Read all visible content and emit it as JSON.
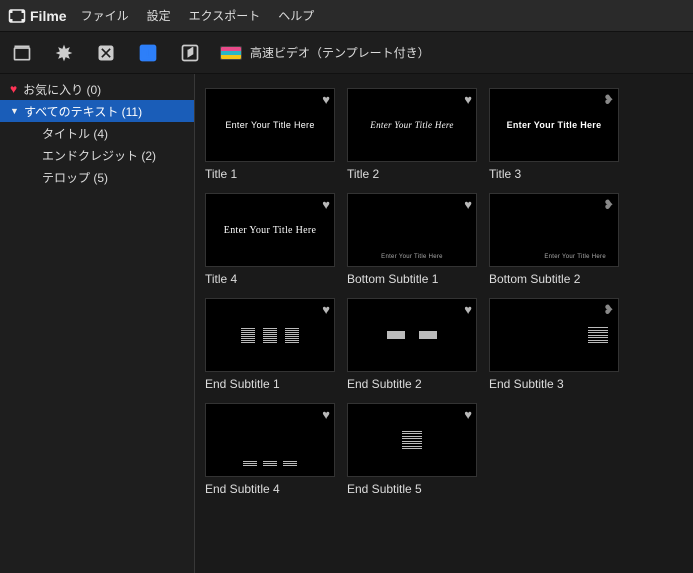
{
  "app": {
    "name": "Filme"
  },
  "menu": [
    "ファイル",
    "設定",
    "エクスポート",
    "ヘルプ"
  ],
  "toolbar": {
    "quickvideo_label": "高速ビデオ（テンプレート付き）"
  },
  "sidebar": {
    "items": [
      {
        "label": "お気に入り (0)",
        "icon": "heart"
      },
      {
        "label": "すべてのテキスト (11)",
        "icon": "disclosure",
        "selected": true
      },
      {
        "label": "タイトル (4)",
        "indent": true
      },
      {
        "label": "エンドクレジット (2)",
        "indent": true
      },
      {
        "label": "テロップ (5)",
        "indent": true
      }
    ]
  },
  "templates": [
    {
      "caption": "Title 1",
      "thumb_text": "Enter Your Title Here",
      "style": "sans"
    },
    {
      "caption": "Title 2",
      "thumb_text": "Enter Your Title Here",
      "style": "italic"
    },
    {
      "caption": "Title 3",
      "thumb_text": "Enter Your Title Here",
      "style": "bold",
      "broken_heart": true
    },
    {
      "caption": "Title 4",
      "thumb_text": "Enter Your Title Here",
      "style": "serif"
    },
    {
      "caption": "Bottom Subtitle 1",
      "thumb_text": "Enter Your Title Here",
      "style": "bottom"
    },
    {
      "caption": "Bottom Subtitle 2",
      "thumb_text": "Enter Your Title Here",
      "style": "bottom2",
      "broken_heart": true
    },
    {
      "caption": "End Subtitle 1",
      "style": "cols3"
    },
    {
      "caption": "End Subtitle 2",
      "style": "cols2w"
    },
    {
      "caption": "End Subtitle 3",
      "style": "col1r",
      "broken_heart": true
    },
    {
      "caption": "End Subtitle 4",
      "style": "triple"
    },
    {
      "caption": "End Subtitle 5",
      "style": "centercol"
    }
  ],
  "colors": {
    "accent": "#2d7ff9",
    "selection": "#1a5db8",
    "heart": "#ff3355"
  }
}
